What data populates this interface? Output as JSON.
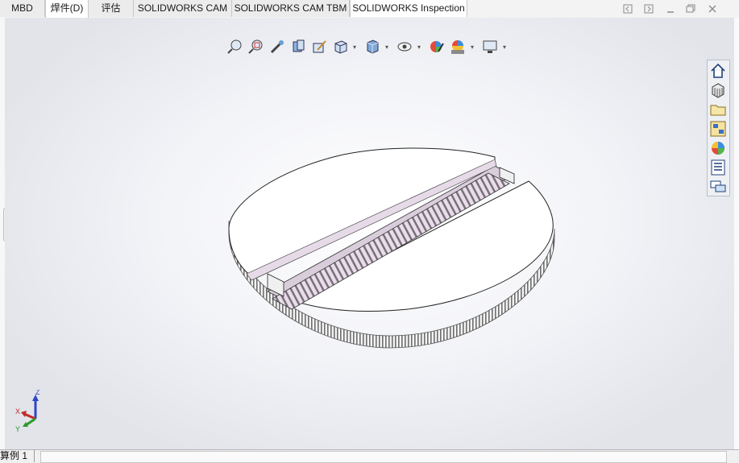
{
  "tabs": [
    {
      "label": "MBD"
    },
    {
      "label": "焊件(D)"
    },
    {
      "label": "评估"
    },
    {
      "label": "SOLIDWORKS CAM"
    },
    {
      "label": "SOLIDWORKS CAM TBM"
    },
    {
      "label": "SOLIDWORKS Inspection"
    }
  ],
  "active_tab_index": 1,
  "window_controls": [
    "restore-left-icon",
    "restore-right-icon",
    "minimize-icon",
    "maximize-icon",
    "close-icon"
  ],
  "heads_up_toolbar": [
    "zoom-to-fit-icon",
    "zoom-to-area-icon",
    "previous-view-icon",
    "section-view-icon",
    "dynamic-annotation-icon",
    "view-orientation-icon",
    "display-style-icon",
    "hide-show-items-icon",
    "edit-appearance-icon",
    "apply-scene-icon",
    "view-settings-icon"
  ],
  "task_pane": [
    "solidworks-resources-icon",
    "design-library-icon",
    "file-explorer-icon",
    "view-palette-icon",
    "appearances-scenes-icon",
    "custom-properties-icon",
    "forum-icon"
  ],
  "triad": {
    "x_label": "X",
    "y_label": "Y",
    "z_label": "Z"
  },
  "status": {
    "text": "算例 1"
  },
  "colors": {
    "model_face": "#ffffff",
    "rack_face": "#e4d8e6",
    "gear_teeth": "#8c8c8c",
    "viewport_edge": "#e2e4ea"
  }
}
